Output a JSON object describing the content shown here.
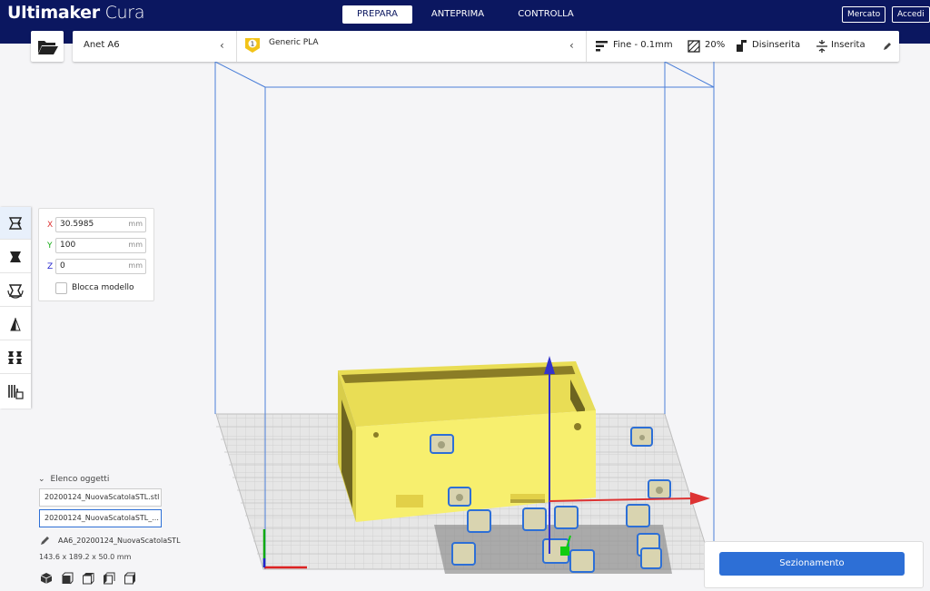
{
  "app": {
    "logo_brand": "Ultimaker",
    "logo_product": "Cura"
  },
  "nav": {
    "tabs": [
      "PREPARA",
      "ANTEPRIMA",
      "CONTROLLA"
    ],
    "active": "PREPARA"
  },
  "header_buttons": {
    "marketplace": "Mercato",
    "login": "Accedi"
  },
  "config": {
    "printer": "Anet A6",
    "extruder_number": "1",
    "material": "Generic PLA",
    "profile": "Fine - 0.1mm",
    "infill": "20%",
    "support": "Disinserita",
    "adhesion": "Inserita"
  },
  "move_tool": {
    "x_label": "X",
    "x_value": "30.5985",
    "y_label": "Y",
    "y_value": "100",
    "z_label": "Z",
    "z_value": "0",
    "unit": "mm",
    "lock_model_label": "Blocca modello",
    "lock_model_checked": false
  },
  "object_list": {
    "title": "Elenco oggetti",
    "items": [
      "20200124_NuovaScatolaSTL.stl",
      "20200124_NuovaScatolaSTL_..."
    ],
    "selected_index": 1
  },
  "scene_info": {
    "file_name": "AA6_20200124_NuovaScatolaSTL",
    "dimensions": "143.6 x 189.2 x 50.0 mm"
  },
  "slice": {
    "button_label": "Sezionamento"
  },
  "colors": {
    "header": "#0b1760",
    "accent": "#2d6fd6",
    "model": "#f7ef6e",
    "axis_x": "#d33",
    "axis_y": "#1c1",
    "axis_z": "#3333cc"
  },
  "tool_icons": [
    "move-icon",
    "scale-icon",
    "rotate-icon",
    "mirror-icon",
    "per-model-settings-icon",
    "support-blocker-icon"
  ]
}
